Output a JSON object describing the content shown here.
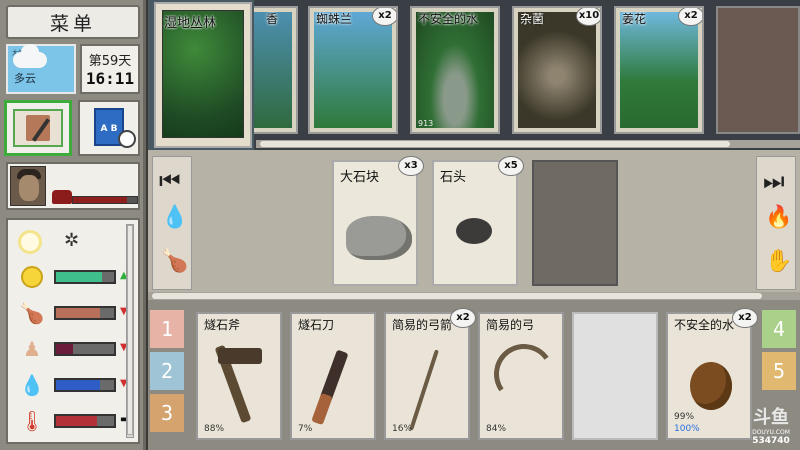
{
  "sidebar": {
    "menu_label": "菜单",
    "weather": {
      "label": "多云",
      "small": "大气"
    },
    "clock": {
      "day": "第59天",
      "time": "16:11"
    }
  },
  "status": {
    "weight_level": 0.85,
    "mood_level": 0.8,
    "hunger_level": 0.75,
    "health_level": 0.3,
    "thirst_level": 0.75,
    "temp_level": 0.7
  },
  "location": {
    "name": "湿地丛林"
  },
  "top_cards": [
    {
      "name": "香",
      "badge": "",
      "meta": ""
    },
    {
      "name": "蜘蛛兰",
      "badge": "x2",
      "meta": ""
    },
    {
      "name": "不安全的水",
      "badge": "",
      "meta": "913"
    },
    {
      "name": "杂菌",
      "badge": "x10",
      "meta": ""
    },
    {
      "name": "姜花",
      "badge": "x2",
      "meta": ""
    }
  ],
  "middle_cards": [
    {
      "name": "大石块",
      "badge": "x3"
    },
    {
      "name": "石头",
      "badge": "x5"
    }
  ],
  "bottom_cards": [
    {
      "name": "燧石斧",
      "badge": "",
      "dur": "88%"
    },
    {
      "name": "燧石刀",
      "badge": "",
      "dur": "7%"
    },
    {
      "name": "简易的弓箭",
      "badge": "x2",
      "dur": "16%"
    },
    {
      "name": "简易的弓",
      "badge": "",
      "dur": "84%"
    },
    {
      "name": "不安全的水",
      "badge": "x2",
      "dur": "99%",
      "dur2": "100%"
    }
  ],
  "tabs_left": [
    "1",
    "2",
    "3"
  ],
  "tabs_right": [
    "4",
    "5"
  ],
  "watermark": {
    "logo": "斗鱼",
    "sub": "DOUYU.COM",
    "id": "534740"
  }
}
